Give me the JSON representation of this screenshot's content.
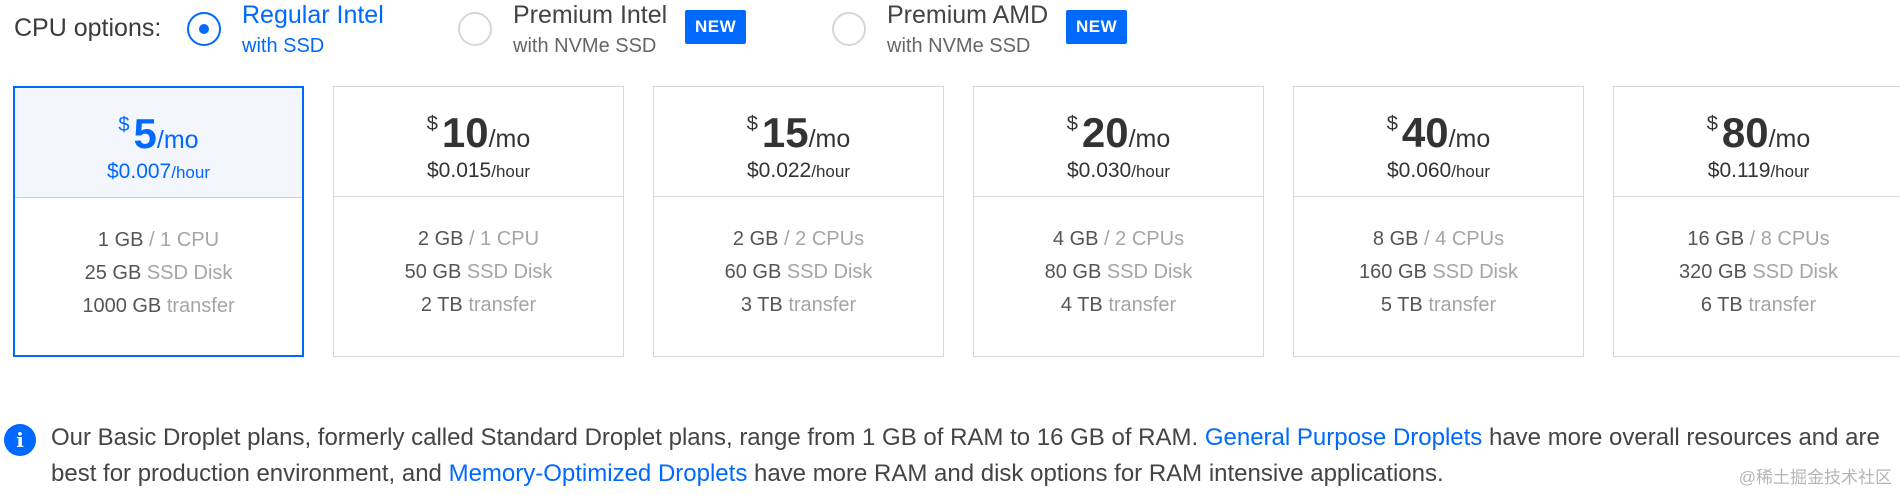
{
  "cpu_options": {
    "label": "CPU options:",
    "options": [
      {
        "title": "Regular Intel",
        "subtitle": "with SSD",
        "selected": true,
        "badge": ""
      },
      {
        "title": "Premium Intel",
        "subtitle": "with NVMe SSD",
        "selected": false,
        "badge": "NEW"
      },
      {
        "title": "Premium AMD",
        "subtitle": "with NVMe SSD",
        "selected": false,
        "badge": "NEW"
      }
    ]
  },
  "plans": [
    {
      "currency": "$",
      "amount": "5",
      "period": "/mo",
      "hourly": "$0.007",
      "hourly_unit": "/hour",
      "memory": "1 GB",
      "cpu": "/ 1 CPU",
      "disk": "25 GB",
      "disk_unit": "SSD Disk",
      "transfer": "1000 GB",
      "transfer_unit": "transfer",
      "selected": true
    },
    {
      "currency": "$",
      "amount": "10",
      "period": "/mo",
      "hourly": "$0.015",
      "hourly_unit": "/hour",
      "memory": "2 GB",
      "cpu": "/ 1 CPU",
      "disk": "50 GB",
      "disk_unit": "SSD Disk",
      "transfer": "2 TB",
      "transfer_unit": "transfer",
      "selected": false
    },
    {
      "currency": "$",
      "amount": "15",
      "period": "/mo",
      "hourly": "$0.022",
      "hourly_unit": "/hour",
      "memory": "2 GB",
      "cpu": "/ 2 CPUs",
      "disk": "60 GB",
      "disk_unit": "SSD Disk",
      "transfer": "3 TB",
      "transfer_unit": "transfer",
      "selected": false
    },
    {
      "currency": "$",
      "amount": "20",
      "period": "/mo",
      "hourly": "$0.030",
      "hourly_unit": "/hour",
      "memory": "4 GB",
      "cpu": "/ 2 CPUs",
      "disk": "80 GB",
      "disk_unit": "SSD Disk",
      "transfer": "4 TB",
      "transfer_unit": "transfer",
      "selected": false
    },
    {
      "currency": "$",
      "amount": "40",
      "period": "/mo",
      "hourly": "$0.060",
      "hourly_unit": "/hour",
      "memory": "8 GB",
      "cpu": "/ 4 CPUs",
      "disk": "160 GB",
      "disk_unit": "SSD Disk",
      "transfer": "5 TB",
      "transfer_unit": "transfer",
      "selected": false
    },
    {
      "currency": "$",
      "amount": "80",
      "period": "/mo",
      "hourly": "$0.119",
      "hourly_unit": "/hour",
      "memory": "16 GB",
      "cpu": "/ 8 CPUs",
      "disk": "320 GB",
      "disk_unit": "SSD Disk",
      "transfer": "6 TB",
      "transfer_unit": "transfer",
      "selected": false
    }
  ],
  "info_note": {
    "icon": "info-icon",
    "text_1": "Our Basic Droplet plans, formerly called Standard Droplet plans, range from 1 GB of RAM to 16 GB of RAM. ",
    "link_1": "General Purpose Droplets",
    "text_2": " have more overall resources and are best for production environment, and ",
    "link_2": "Memory-Optimized Droplets",
    "text_3": " have more RAM and disk options for RAM intensive applications."
  },
  "watermark": "@稀土掘金技术社区",
  "colors": {
    "accent": "#0069ff",
    "border": "#d9d9d9",
    "muted": "#a5a5a5"
  }
}
